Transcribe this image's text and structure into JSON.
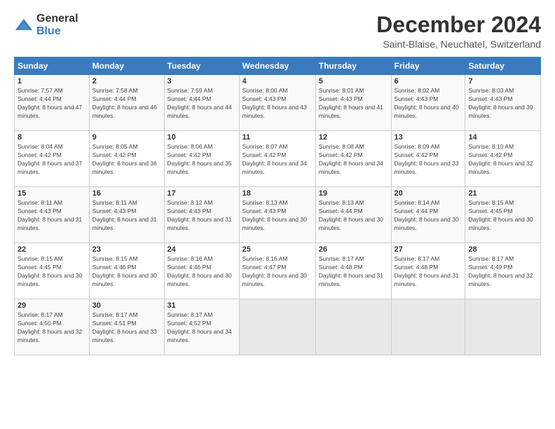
{
  "logo": {
    "text_general": "General",
    "text_blue": "Blue"
  },
  "title": "December 2024",
  "subtitle": "Saint-Blaise, Neuchatel, Switzerland",
  "days_of_week": [
    "Sunday",
    "Monday",
    "Tuesday",
    "Wednesday",
    "Thursday",
    "Friday",
    "Saturday"
  ],
  "weeks": [
    [
      {
        "day": "1",
        "sunrise": "Sunrise: 7:57 AM",
        "sunset": "Sunset: 4:44 PM",
        "daylight": "Daylight: 8 hours and 47 minutes."
      },
      {
        "day": "2",
        "sunrise": "Sunrise: 7:58 AM",
        "sunset": "Sunset: 4:44 PM",
        "daylight": "Daylight: 8 hours and 46 minutes."
      },
      {
        "day": "3",
        "sunrise": "Sunrise: 7:59 AM",
        "sunset": "Sunset: 4:44 PM",
        "daylight": "Daylight: 8 hours and 44 minutes."
      },
      {
        "day": "4",
        "sunrise": "Sunrise: 8:00 AM",
        "sunset": "Sunset: 4:43 PM",
        "daylight": "Daylight: 8 hours and 43 minutes."
      },
      {
        "day": "5",
        "sunrise": "Sunrise: 8:01 AM",
        "sunset": "Sunset: 4:43 PM",
        "daylight": "Daylight: 8 hours and 41 minutes."
      },
      {
        "day": "6",
        "sunrise": "Sunrise: 8:02 AM",
        "sunset": "Sunset: 4:43 PM",
        "daylight": "Daylight: 8 hours and 40 minutes."
      },
      {
        "day": "7",
        "sunrise": "Sunrise: 8:03 AM",
        "sunset": "Sunset: 4:43 PM",
        "daylight": "Daylight: 8 hours and 39 minutes."
      }
    ],
    [
      {
        "day": "8",
        "sunrise": "Sunrise: 8:04 AM",
        "sunset": "Sunset: 4:42 PM",
        "daylight": "Daylight: 8 hours and 37 minutes."
      },
      {
        "day": "9",
        "sunrise": "Sunrise: 8:05 AM",
        "sunset": "Sunset: 4:42 PM",
        "daylight": "Daylight: 8 hours and 36 minutes."
      },
      {
        "day": "10",
        "sunrise": "Sunrise: 8:06 AM",
        "sunset": "Sunset: 4:42 PM",
        "daylight": "Daylight: 8 hours and 35 minutes."
      },
      {
        "day": "11",
        "sunrise": "Sunrise: 8:07 AM",
        "sunset": "Sunset: 4:42 PM",
        "daylight": "Daylight: 8 hours and 34 minutes."
      },
      {
        "day": "12",
        "sunrise": "Sunrise: 8:08 AM",
        "sunset": "Sunset: 4:42 PM",
        "daylight": "Daylight: 8 hours and 34 minutes."
      },
      {
        "day": "13",
        "sunrise": "Sunrise: 8:09 AM",
        "sunset": "Sunset: 4:42 PM",
        "daylight": "Daylight: 8 hours and 33 minutes."
      },
      {
        "day": "14",
        "sunrise": "Sunrise: 8:10 AM",
        "sunset": "Sunset: 4:42 PM",
        "daylight": "Daylight: 8 hours and 32 minutes."
      }
    ],
    [
      {
        "day": "15",
        "sunrise": "Sunrise: 8:11 AM",
        "sunset": "Sunset: 4:43 PM",
        "daylight": "Daylight: 8 hours and 31 minutes."
      },
      {
        "day": "16",
        "sunrise": "Sunrise: 8:11 AM",
        "sunset": "Sunset: 4:43 PM",
        "daylight": "Daylight: 8 hours and 31 minutes."
      },
      {
        "day": "17",
        "sunrise": "Sunrise: 8:12 AM",
        "sunset": "Sunset: 4:43 PM",
        "daylight": "Daylight: 8 hours and 31 minutes."
      },
      {
        "day": "18",
        "sunrise": "Sunrise: 8:13 AM",
        "sunset": "Sunset: 4:43 PM",
        "daylight": "Daylight: 8 hours and 30 minutes."
      },
      {
        "day": "19",
        "sunrise": "Sunrise: 8:13 AM",
        "sunset": "Sunset: 4:44 PM",
        "daylight": "Daylight: 8 hours and 30 minutes."
      },
      {
        "day": "20",
        "sunrise": "Sunrise: 8:14 AM",
        "sunset": "Sunset: 4:44 PM",
        "daylight": "Daylight: 8 hours and 30 minutes."
      },
      {
        "day": "21",
        "sunrise": "Sunrise: 8:15 AM",
        "sunset": "Sunset: 4:45 PM",
        "daylight": "Daylight: 8 hours and 30 minutes."
      }
    ],
    [
      {
        "day": "22",
        "sunrise": "Sunrise: 8:15 AM",
        "sunset": "Sunset: 4:45 PM",
        "daylight": "Daylight: 8 hours and 30 minutes."
      },
      {
        "day": "23",
        "sunrise": "Sunrise: 8:15 AM",
        "sunset": "Sunset: 4:46 PM",
        "daylight": "Daylight: 8 hours and 30 minutes."
      },
      {
        "day": "24",
        "sunrise": "Sunrise: 8:16 AM",
        "sunset": "Sunset: 4:46 PM",
        "daylight": "Daylight: 8 hours and 30 minutes."
      },
      {
        "day": "25",
        "sunrise": "Sunrise: 8:16 AM",
        "sunset": "Sunset: 4:47 PM",
        "daylight": "Daylight: 8 hours and 30 minutes."
      },
      {
        "day": "26",
        "sunrise": "Sunrise: 8:17 AM",
        "sunset": "Sunset: 4:48 PM",
        "daylight": "Daylight: 8 hours and 31 minutes."
      },
      {
        "day": "27",
        "sunrise": "Sunrise: 8:17 AM",
        "sunset": "Sunset: 4:48 PM",
        "daylight": "Daylight: 8 hours and 31 minutes."
      },
      {
        "day": "28",
        "sunrise": "Sunrise: 8:17 AM",
        "sunset": "Sunset: 4:49 PM",
        "daylight": "Daylight: 8 hours and 32 minutes."
      }
    ],
    [
      {
        "day": "29",
        "sunrise": "Sunrise: 8:17 AM",
        "sunset": "Sunset: 4:50 PM",
        "daylight": "Daylight: 8 hours and 32 minutes."
      },
      {
        "day": "30",
        "sunrise": "Sunrise: 8:17 AM",
        "sunset": "Sunset: 4:51 PM",
        "daylight": "Daylight: 8 hours and 33 minutes."
      },
      {
        "day": "31",
        "sunrise": "Sunrise: 8:17 AM",
        "sunset": "Sunset: 4:52 PM",
        "daylight": "Daylight: 8 hours and 34 minutes."
      },
      null,
      null,
      null,
      null
    ]
  ]
}
